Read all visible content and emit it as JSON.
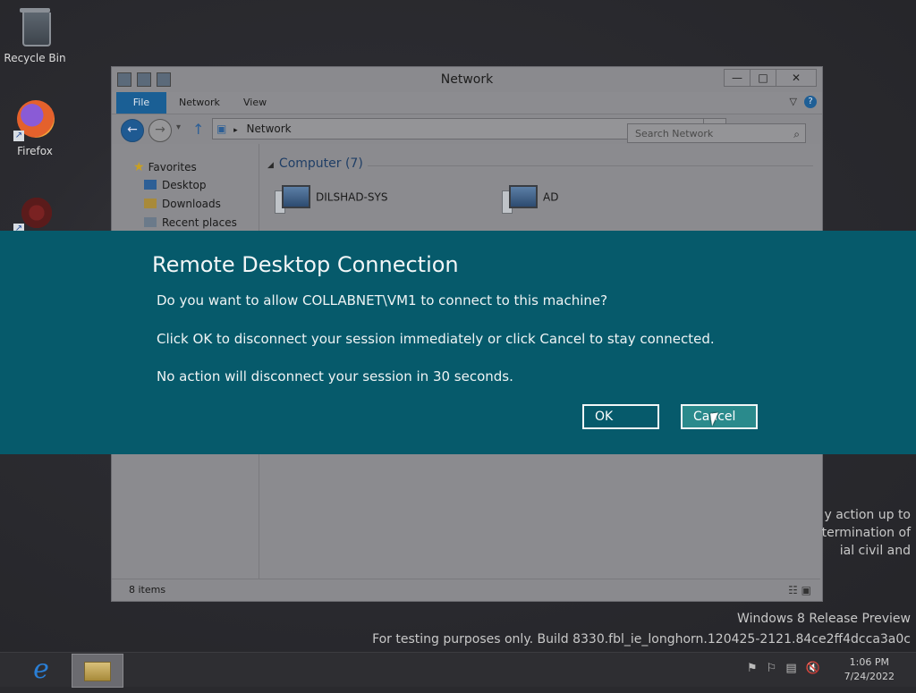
{
  "desktop": {
    "icons": [
      {
        "label": "Recycle Bin"
      },
      {
        "label": "Firefox"
      },
      {
        "label": ""
      }
    ],
    "legal_text": [
      "y action up to",
      "termination of",
      "ial civil and"
    ],
    "watermark": {
      "line1": "Windows 8 Release Preview",
      "line2": "For testing purposes only. Build 8330.fbl_ie_longhorn.120425-2121.84ce2ff4dcca3a0c"
    }
  },
  "explorer": {
    "title": "Network",
    "window_controls": {
      "minimize": "—",
      "maximize": "□",
      "close": "✕"
    },
    "ribbon_tabs": {
      "file": "File",
      "network": "Network",
      "view": "View"
    },
    "address": {
      "path": "Network"
    },
    "search": {
      "placeholder": "Search Network"
    },
    "nav_pane": {
      "favorites": "Favorites",
      "items": [
        "Desktop",
        "Downloads",
        "Recent places"
      ]
    },
    "group": {
      "label": "Computer (7)"
    },
    "computers": [
      "DILSHAD-SYS",
      "AD"
    ],
    "status": {
      "count": "8 items"
    }
  },
  "dialog": {
    "title": "Remote Desktop Connection",
    "line1": "Do you want to allow COLLABNET\\VM1 to connect to this machine?",
    "line2": "Click OK to disconnect your session immediately or click Cancel to stay connected.",
    "line3": "No action will disconnect your session in 30 seconds.",
    "ok_label": "OK",
    "cancel_label": "Cancel"
  },
  "taskbar": {
    "clock_time": "1:06 PM",
    "clock_date": "7/24/2022"
  },
  "colors": {
    "dialog_band": "#065a6b",
    "cancel_fill": "#2a8a8c",
    "file_tab": "#1a5f95"
  }
}
